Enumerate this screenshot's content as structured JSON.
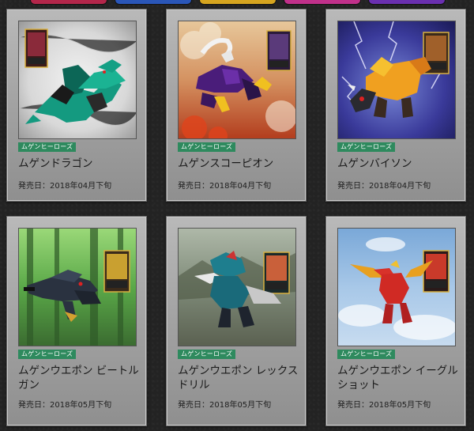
{
  "top_tabs": [
    {
      "color": "#b3264a"
    },
    {
      "color": "#2a56b8"
    },
    {
      "color": "#d6a51f"
    },
    {
      "color": "#c0308a"
    },
    {
      "color": "#6a2fb0"
    }
  ],
  "products": [
    {
      "tag": "ムゲンヒーローズ",
      "name": "ムゲンドラゴン",
      "release": "発売日：2018年04月下旬",
      "image": "green-dragon-figure-with-card",
      "accent": "#17a88a"
    },
    {
      "tag": "ムゲンヒーローズ",
      "name": "ムゲンスコーピオン",
      "release": "発売日：2018年04月下旬",
      "image": "purple-scorpion-figure-with-card",
      "accent": "#6a2bb0"
    },
    {
      "tag": "ムゲンヒーローズ",
      "name": "ムゲンバイソン",
      "release": "発売日：2018年04月下旬",
      "image": "gold-bison-figure-with-card",
      "accent": "#e6a21c"
    },
    {
      "tag": "ムゲンヒーローズ",
      "name": "ムゲンウエポン ビートルガン",
      "release": "発売日：2018年05月下旬",
      "image": "beetle-gun-figure-with-card",
      "accent": "#3a4a5a"
    },
    {
      "tag": "ムゲンヒーローズ",
      "name": "ムゲンウエポン レックスドリル",
      "release": "発売日：2018年05月下旬",
      "image": "rex-drill-figure-with-card",
      "accent": "#1e6e7e"
    },
    {
      "tag": "ムゲンヒーローズ",
      "name": "ムゲンウエポン イーグルショット",
      "release": "発売日：2018年05月下旬",
      "image": "eagle-shot-figure-with-card",
      "accent": "#d8322a"
    }
  ]
}
